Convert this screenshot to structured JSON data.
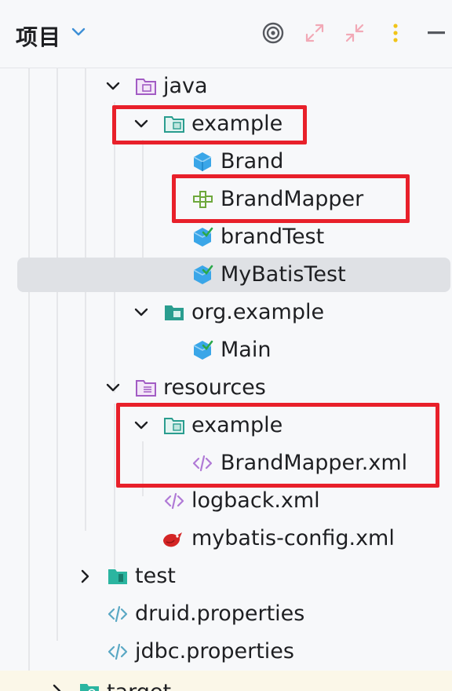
{
  "header": {
    "title": "项目"
  },
  "tree": [
    {
      "label": "java"
    },
    {
      "label": "example"
    },
    {
      "label": "Brand"
    },
    {
      "label": "BrandMapper"
    },
    {
      "label": "brandTest"
    },
    {
      "label": "MyBatisTest"
    },
    {
      "label": "org.example"
    },
    {
      "label": "Main"
    },
    {
      "label": "resources"
    },
    {
      "label": "example"
    },
    {
      "label": "BrandMapper.xml"
    },
    {
      "label": "logback.xml"
    },
    {
      "label": "mybatis-config.xml"
    },
    {
      "label": "test"
    },
    {
      "label": "druid.properties"
    },
    {
      "label": "jdbc.properties"
    },
    {
      "label": "target"
    }
  ],
  "colors": {
    "highlight": "#e8202a",
    "selection": "#dfe1e5"
  }
}
